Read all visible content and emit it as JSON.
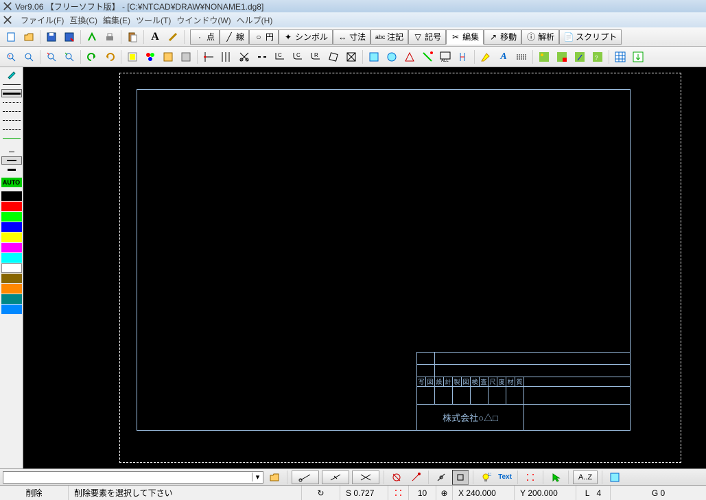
{
  "window": {
    "title": "Ver9.06 【フリーソフト版】 - [C:¥NTCAD¥DRAW¥NONAME1.dg8]"
  },
  "menu": {
    "file": "ファイル(F)",
    "compat": "互換(C)",
    "edit": "編集(E)",
    "tool": "ツール(T)",
    "window": "ウインドウ(W)",
    "help": "ヘルプ(H)"
  },
  "tabs": {
    "point": "点",
    "line": "線",
    "circle": "円",
    "symbol": "シンボル",
    "dimension": "寸法",
    "note": "注記",
    "mark": "記号",
    "edit": "編集",
    "move": "移動",
    "analyze": "解析",
    "script": "スクリプト"
  },
  "leftpanel": {
    "auto": "AUTO"
  },
  "titleblock": {
    "company": "株式会社○△□",
    "h1": "写",
    "h2": "図",
    "h3": "設",
    "h4": "計",
    "h5": "製",
    "h6": "図",
    "h7": "検",
    "h8": "査",
    "h9": "尺",
    "h10": "度",
    "h11": "材",
    "h12": "質"
  },
  "bottombar": {
    "letters": "A..Z"
  },
  "status": {
    "mode": "削除",
    "prompt": "削除要素を選択して下さい",
    "scale": "S 0.727",
    "grid": "10",
    "x_label": "X",
    "x_val": "240.000",
    "y_label": "Y",
    "y_val": "200.000",
    "l_label": "L",
    "l_val": "4",
    "g_label": "G",
    "g_val": "0"
  },
  "colors": {
    "palette": [
      "#000000",
      "#ff0000",
      "#00ff00",
      "#0000ff",
      "#ffff00",
      "#ff00ff",
      "#00ffff",
      "#ffffff",
      "#808040",
      "#ff8000",
      "#008080",
      "#0080ff"
    ]
  }
}
